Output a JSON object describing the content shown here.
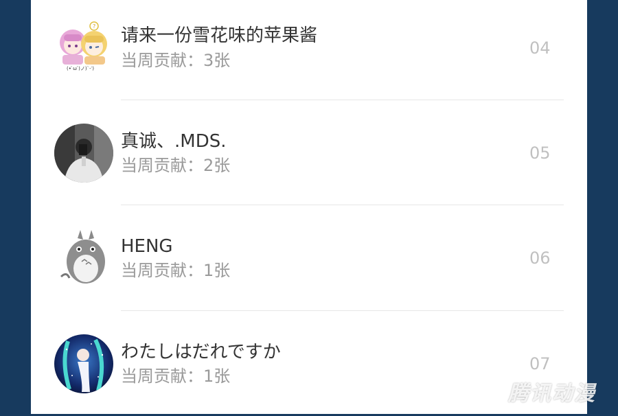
{
  "contributors": [
    {
      "name": "请来一份雪花味的苹果酱",
      "contribution": "当周贡献：3张",
      "rank": "04",
      "avatar_caption": "(• ̀ω ́)ノ)`-‵)"
    },
    {
      "name": "真诚、.MDS.",
      "contribution": "当周贡献：2张",
      "rank": "05"
    },
    {
      "name": "HENG",
      "contribution": "当周贡献：1张",
      "rank": "06"
    },
    {
      "name": "わたしはだれですか",
      "contribution": "当周贡献：1张",
      "rank": "07"
    }
  ],
  "watermark": "腾讯动漫"
}
